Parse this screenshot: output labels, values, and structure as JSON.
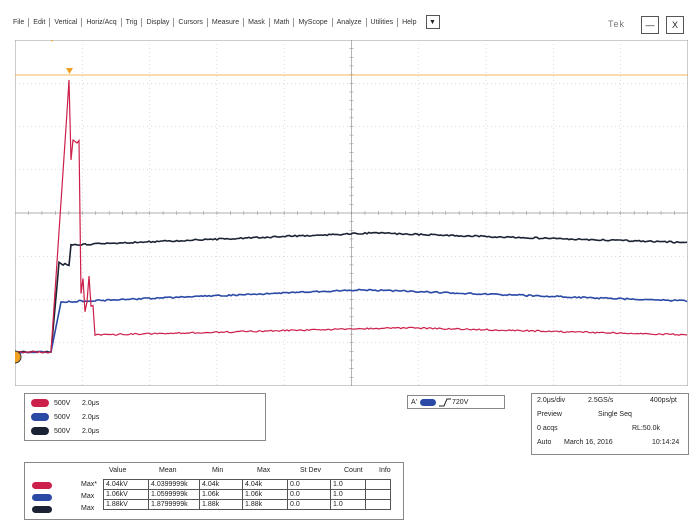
{
  "menu": {
    "items": [
      "File",
      "Edit",
      "Vertical",
      "Horiz/Acq",
      "Trig",
      "Display",
      "Cursors",
      "Measure",
      "Mask",
      "Math",
      "MyScope",
      "Analyze",
      "Utilities",
      "Help"
    ],
    "dropdown_icon": "chevron-down-icon",
    "brand": "Tek",
    "minimize_label": "—",
    "close_label": "X"
  },
  "colors": {
    "ch1": "#cc1f4a",
    "ch2": "#2a4aa6",
    "ch3": "#1b2233",
    "grid": "#b9b9b9",
    "trigger": "#f0a020"
  },
  "channels": [
    {
      "scale": "500V",
      "timebase": "2.0μs",
      "color": "#cc1f4a"
    },
    {
      "scale": "500V",
      "timebase": "2.0μs",
      "color": "#2a4aa6"
    },
    {
      "scale": "500V",
      "timebase": "2.0μs",
      "color": "#1b2233"
    }
  ],
  "trigger": {
    "source": "A'",
    "level": "720V"
  },
  "acquisition": {
    "horizontal": "2.0μs/div",
    "sample_rate": "2.5GS/s",
    "resolution": "400ps/pt",
    "mode": "Preview",
    "sequence": "Single Seq",
    "acqs": "0 acqs",
    "record_length": "RL:50.0k",
    "run_mode": "Auto",
    "date": "March 16, 2016",
    "time": "10:14:24"
  },
  "measurements": {
    "headers": [
      "Value",
      "Mean",
      "Min",
      "Max",
      "St Dev",
      "Count",
      "Info"
    ],
    "rows": [
      {
        "label": "Max*",
        "color": "#cc1f4a",
        "cells": [
          "4.04kV",
          "4.0399999k",
          "4.04k",
          "4.04k",
          "0.0",
          "1.0",
          ""
        ]
      },
      {
        "label": "Max",
        "color": "#2a4aa6",
        "cells": [
          "1.06kV",
          "1.0599999k",
          "1.06k",
          "1.06k",
          "0.0",
          "1.0",
          ""
        ]
      },
      {
        "label": "Max",
        "color": "#1b2233",
        "cells": [
          "1.88kV",
          "1.8799999k",
          "1.88k",
          "1.88k",
          "0.0",
          "1.0",
          ""
        ]
      }
    ]
  }
}
